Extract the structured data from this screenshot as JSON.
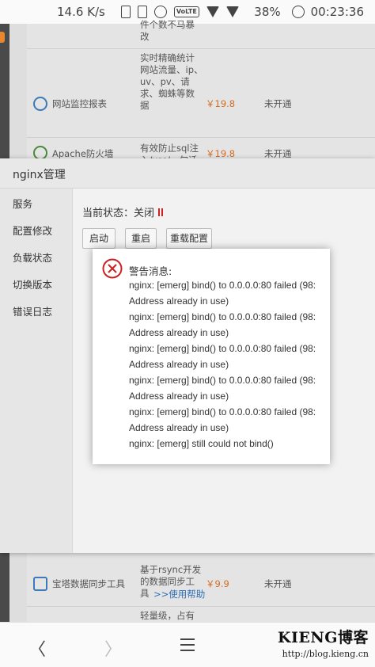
{
  "status_bar": {
    "speed": "14.6 K/s",
    "volte": "VoLTE",
    "battery": "38%",
    "time": "00:23:36"
  },
  "bg_table": {
    "rows": [
      {
        "name": "",
        "desc": "件个数不马暴\n改",
        "price": "",
        "status": ""
      },
      {
        "name": "网站监控报表",
        "desc": "实时精确统计\n网站流量、ip、\nuv、pv、请\n求、蜘蛛等数\n据",
        "price": "￥19.8",
        "status": "未开通"
      },
      {
        "name": "Apache防火墙",
        "desc": "有效防止sql注\n入/xss/一句话\n木马等常见渗\n透攻击,当前仅",
        "price": "￥19.8",
        "status": "未开通"
      },
      {
        "name": "宝塔数据同步工具",
        "desc": "基于rsync开发\n的数据同步工\n具",
        "link": ">>使用帮助",
        "price": "￥9.9",
        "status": "未开通"
      },
      {
        "name": "",
        "desc": "轻量级，占有",
        "price": "",
        "status": ""
      }
    ]
  },
  "panel": {
    "title": "nginx管理",
    "nav": [
      "服务",
      "配置修改",
      "负载状态",
      "切换版本",
      "错误日志"
    ],
    "state_label": "当前状态：关闭",
    "buttons": [
      "启动",
      "重启",
      "重载配置"
    ]
  },
  "dialog": {
    "title": "警告消息:",
    "lines": [
      "nginx: [emerg] bind() to 0.0.0.0:80 failed (98:",
      "Address already in use)",
      "nginx: [emerg] bind() to 0.0.0.0:80 failed (98:",
      "Address already in use)",
      "nginx: [emerg] bind() to 0.0.0.0:80 failed (98:",
      "Address already in use)",
      "nginx: [emerg] bind() to 0.0.0.0:80 failed (98:",
      "Address already in use)",
      "nginx: [emerg] bind() to 0.0.0.0:80 failed (98:",
      "Address already in use)",
      "nginx: [emerg] still could not bind()"
    ]
  },
  "browser_nav": {
    "back": "〈",
    "forward": "〉"
  },
  "watermark": {
    "brand": "KIENG博客",
    "url": "http://blog.kieng.cn"
  },
  "colors": {
    "price": "#d46b22",
    "error": "#cc2222",
    "link": "#2f6fb5"
  }
}
